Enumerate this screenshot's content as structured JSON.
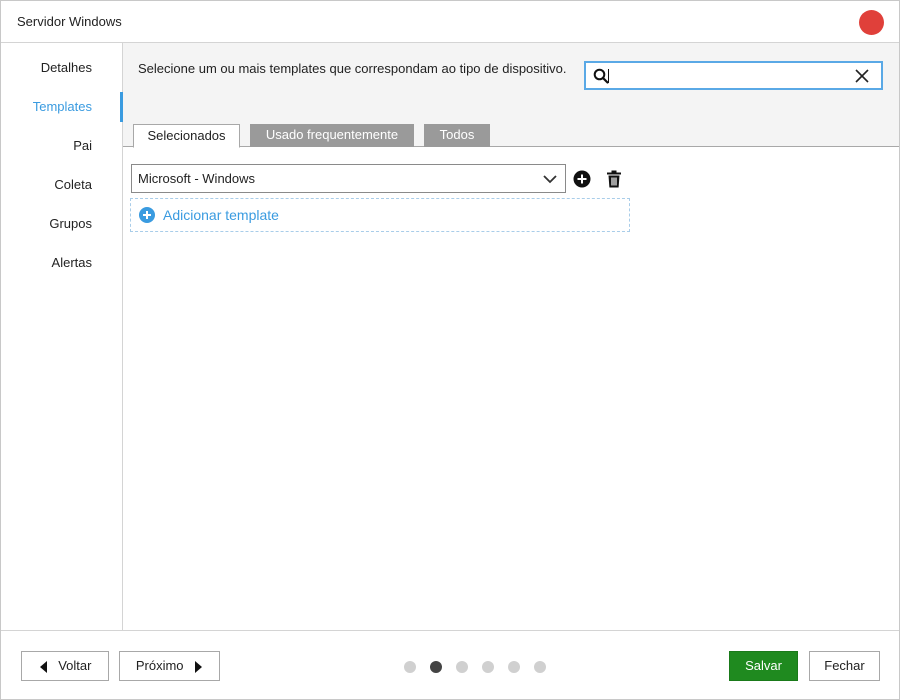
{
  "window": {
    "title": "Servidor Windows",
    "close_color": "#e0403a"
  },
  "sidebar": {
    "items": [
      {
        "label": "Detalhes",
        "active": false
      },
      {
        "label": "Templates",
        "active": true
      },
      {
        "label": "Pai",
        "active": false
      },
      {
        "label": "Coleta",
        "active": false
      },
      {
        "label": "Grupos",
        "active": false
      },
      {
        "label": "Alertas",
        "active": false
      }
    ],
    "accent_color": "#3a9be0"
  },
  "main": {
    "instruction": "Selecione um ou mais templates que correspondam ao tipo de dispositivo.",
    "search": {
      "value": "",
      "placeholder": ""
    },
    "tabs": [
      {
        "label": "Selecionados",
        "active": true
      },
      {
        "label": "Usado frequentemente",
        "active": false
      },
      {
        "label": "Todos",
        "active": false
      }
    ],
    "selected_template": "Microsoft - Windows",
    "add_template_label": "Adicionar template"
  },
  "footer": {
    "back_label": "Voltar",
    "next_label": "Próximo",
    "save_label": "Salvar",
    "close_label": "Fechar",
    "steps_total": 6,
    "current_step": 2,
    "save_color": "#1f8a1f"
  }
}
